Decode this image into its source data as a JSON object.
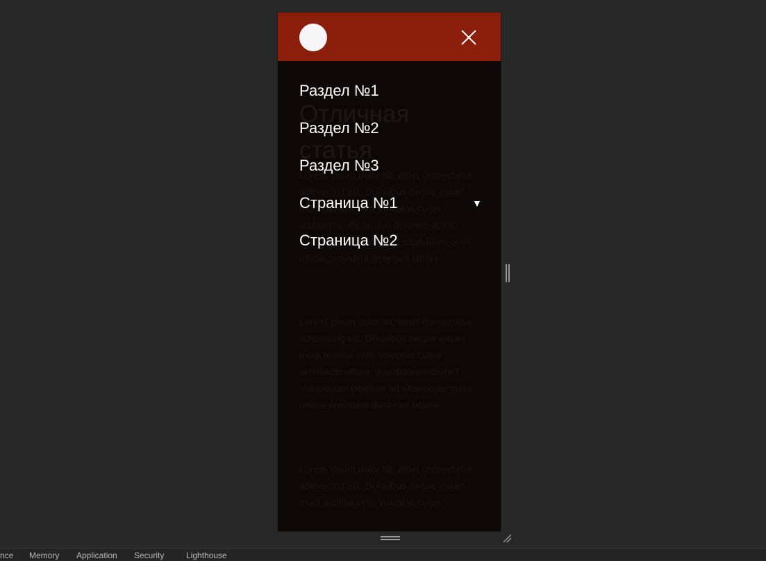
{
  "menu": {
    "items": [
      {
        "label": "Раздел №1"
      },
      {
        "label": "Раздел №2"
      },
      {
        "label": "Раздел №3"
      },
      {
        "label": "Страница №1",
        "caret": "▼"
      },
      {
        "label": "Страница №2"
      }
    ]
  },
  "background_page": {
    "title": "Отличная статья",
    "paragraphs": [
      "Lorem ipsum dolor sit, amet consectetur adipisicing elit. Doloribus neque ipsum modi mollitia velit, voluptas culpa architecto officia, quo dolorem dolor? Voluptatum laborum ad asperiores quos officiis provident deserunt labore.",
      "Lorem ipsum dolor sit, amet consectetur adipisicing elit. Doloribus neque ipsum modi mollitia velit, voluptas culpa architecto officia, quo dolorem dolor? Voluptatum laborum ad asperiores quos officiis provident deserunt labore.",
      "Lorem ipsum dolor sit, amet consectetur adipisicing elit. Doloribus neque ipsum modi mollitia velit, voluptas culpa"
    ]
  },
  "devtools": {
    "tabs": [
      "nce",
      "Memory",
      "Application",
      "Security",
      "Lighthouse"
    ]
  },
  "colors": {
    "header": "#8b1e0a",
    "menu_overlay": "#0b0606",
    "devtools_bg": "#272727"
  },
  "icons": {
    "logo": "circle-logo-icon",
    "close": "close-icon",
    "caret": "caret-down-icon"
  }
}
